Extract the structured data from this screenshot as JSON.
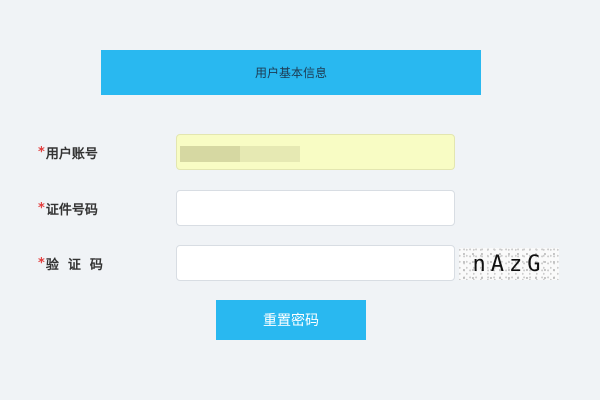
{
  "header": {
    "title": "用户基本信息"
  },
  "form": {
    "account": {
      "required_mark": "*",
      "label": "用户账号",
      "autofilled": true
    },
    "id_number": {
      "required_mark": "*",
      "label": "证件号码",
      "value": ""
    },
    "captcha": {
      "required_mark": "*",
      "label": "验证码",
      "value": "",
      "image_text": "nAzG"
    }
  },
  "buttons": {
    "reset_label": "重置密码"
  },
  "colors": {
    "accent": "#29b8f0",
    "required": "#e23c3c",
    "autofill": "#f8fcc4"
  }
}
